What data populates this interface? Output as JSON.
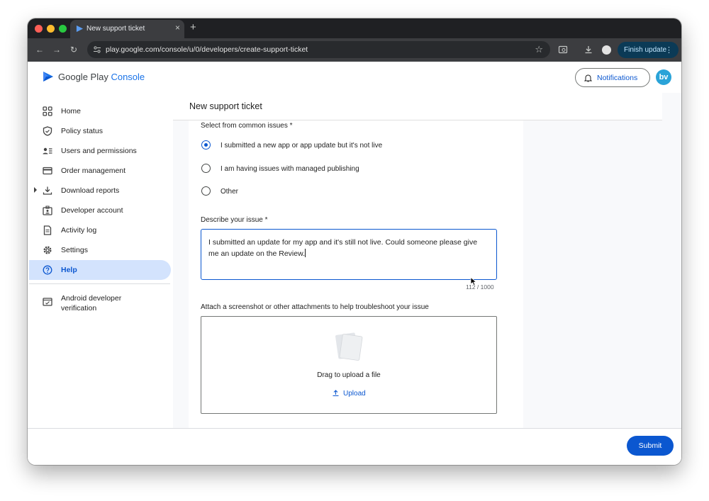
{
  "browser": {
    "tab_title": "New support ticket",
    "tab_close": "×",
    "new_tab": "+",
    "url": "play.google.com/console/u/0/developers/create-support-ticket",
    "finish_update": "Finish update",
    "menu_dots": "⋮",
    "nav": {
      "back": "←",
      "forward": "→",
      "reload": "↻",
      "star": "☆"
    }
  },
  "header": {
    "logo_text": "Google Play",
    "logo_accent": "Console",
    "notifications": "Notifications",
    "avatar": "bv"
  },
  "sidebar": {
    "items": [
      {
        "label": "Home",
        "icon": "grid-icon"
      },
      {
        "label": "Policy status",
        "icon": "shield-icon"
      },
      {
        "label": "Users and permissions",
        "icon": "users-icon"
      },
      {
        "label": "Order management",
        "icon": "card-icon"
      },
      {
        "label": "Download reports",
        "icon": "download-icon"
      },
      {
        "label": "Developer account",
        "icon": "id-badge-icon"
      },
      {
        "label": "Activity log",
        "icon": "document-icon"
      },
      {
        "label": "Settings",
        "icon": "gear-icon"
      },
      {
        "label": "Help",
        "icon": "help-icon",
        "active": true
      }
    ],
    "verification_label": "Android developer verification"
  },
  "ticket": {
    "title": "New support ticket",
    "common_issues_label": "Select from common issues *",
    "options": [
      {
        "label": "I submitted a new app or app update but it's not live",
        "selected": true
      },
      {
        "label": "I am having issues with managed publishing",
        "selected": false
      },
      {
        "label": "Other",
        "selected": false
      }
    ],
    "describe_label": "Describe your issue *",
    "describe_value": "I submitted an update for my app and it's still not live.  Could someone please give me an update on the Review.",
    "char_count": "112 / 1000",
    "attach_label": "Attach a screenshot or other attachments to help troubleshoot your issue",
    "drag_text": "Drag to upload a file",
    "upload_label": "Upload"
  },
  "footer": {
    "submit": "Submit"
  },
  "colors": {
    "accent": "#0b57d0",
    "active_nav_bg": "#d3e3fd",
    "browser_chrome": "#3c3d40"
  }
}
